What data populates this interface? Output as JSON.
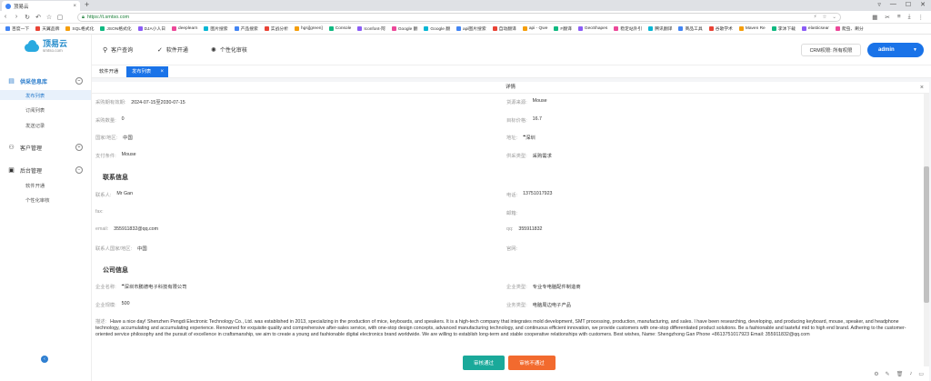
{
  "browser": {
    "tab_title": "顶易云",
    "url": "https://t.smtso.com",
    "bookmarks": [
      "百度一下",
      "天翼品牌",
      "SQL格式化",
      "JSON格式化",
      "DJA小人日",
      "deeplearn",
      "图片搜索",
      "产品搜索",
      "实战分析",
      "hgsj[green]",
      "Console",
      "Iconfont-阿",
      "Google 翻",
      "Google 翻",
      "api图片搜索",
      "自动翻译",
      "api - Qwe",
      "F翻译",
      "GeoShapes",
      "稳定站外引",
      "腾讯翻译",
      "商品工具",
      "谷歌学术",
      "Maven Re",
      "李沐下载",
      "elasticsear",
      "爬虫、刷分"
    ]
  },
  "logo": {
    "name": "顶易云",
    "domain": "smtso.com"
  },
  "sidebar": {
    "groups": [
      {
        "label": "供采信息库",
        "items": [
          "发布列表",
          "订阅列表",
          "发送记录"
        ]
      },
      {
        "label": "客户管理",
        "items": []
      },
      {
        "label": "后台管理",
        "items": [
          "软件开通",
          "个性化审核"
        ]
      }
    ]
  },
  "topnav": {
    "items": [
      "客户查询",
      "软件开通",
      "个性化审核"
    ],
    "crm": "CRM权限: 所有权限",
    "user": "admin"
  },
  "tabs": {
    "home": "软件开通",
    "active": "发布列表"
  },
  "dialog": {
    "title": "详情",
    "fields": {
      "valid_period_label": "采购期有效期:",
      "valid_period": "2024-07-15至2030-07-15",
      "source_label": "货源来源:",
      "source": "Mouse",
      "qty_label": "采购数量:",
      "qty": "0",
      "target_price_label": "目标价格:",
      "target_price": "16.7",
      "country_label": "国家/地区:",
      "country": "中国",
      "address_label": "地址:",
      "address": "深圳",
      "pay_label": "支付条件:",
      "pay": "Mouse",
      "supply_type_label": "供采类型:",
      "supply_type": "采购需求"
    },
    "contact": {
      "title": "联系信息",
      "person_label": "联系人:",
      "person": "Mr Gan",
      "phone_label": "电话:",
      "phone": "13751017923",
      "fax_label": "fax:",
      "fax": "",
      "mail_label": "邮箱:",
      "mail": "",
      "email_label": "email:",
      "email": "355911832@qq.com",
      "qq_label": "qq:",
      "qq": "355911832",
      "region_label": "联系人国家/地区:",
      "region": "中国",
      "site_label": "官网:",
      "site": ""
    },
    "company": {
      "title": "公司信息",
      "name_label": "企业名称:",
      "name": "深圳市鹏德电子科技有限公司",
      "type_label": "企业类型:",
      "type": "专业专电脑配件制造商",
      "scale_label": "企业规模:",
      "scale": "500",
      "business_label": "业务类型:",
      "business": "电脑周边电子产品"
    },
    "desc_label": "描述:",
    "desc": "Have a nice day! Shenzhen Pengdi Electronic Technology Co., Ltd. was established in 2013, specializing in the production of mice, keyboards, and speakers. It is a high-tech company that integrates mold development, SMT processing, production, manufacturing, and sales. I have been researching, developing, and producing keyboard, mouse, speaker, and headphone technology, accumulating and accumulating experience. Renowned for exquisite quality and comprehensive after-sales service, with one-stop design concepts, advanced manufacturing technology, and continuous efficient innovation, we provide customers with one-stop differentiated product solutions. Be a fashionable and tasteful mid to high end brand. Adhering to the customer-oriented service philosophy and the pursuit of excellence in craftsmanship, we aim to create a young and fashionable digital electronics brand worldwide. We are willing to establish long-term and stable cooperative relationships with customers. Best wishes, Name: Shengzhong Gan Phone +8613751017923 Email: 355911832@qq.com",
    "btn_pass": "审核通过",
    "btn_fail": "审核不通过"
  }
}
